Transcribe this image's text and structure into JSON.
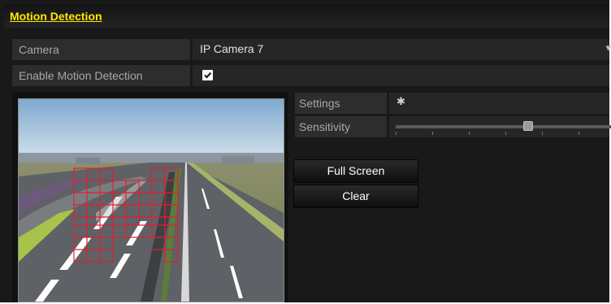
{
  "page": {
    "title": "Motion Detection"
  },
  "camera": {
    "label": "Camera",
    "value": "IP Camera 7",
    "icon": "chevron-down-icon"
  },
  "enable_motion_detection": {
    "label": "Enable Motion Detection",
    "checked": true,
    "icon": "checkmark-icon"
  },
  "settings": {
    "label": "Settings",
    "icon": "gear-icon"
  },
  "sensitivity": {
    "label": "Sensitivity",
    "level": 0.6
  },
  "buttons": {
    "full_screen": "Full Screen",
    "clear": "Clear"
  },
  "preview": {
    "grid_color": "#e0202c",
    "description_icon": "camera-preview"
  }
}
